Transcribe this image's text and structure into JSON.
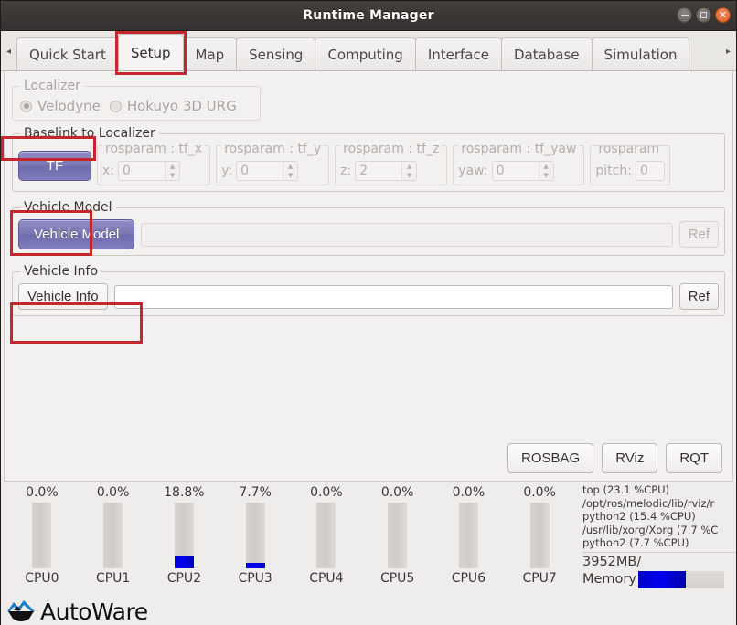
{
  "window": {
    "title": "Runtime Manager",
    "controls": [
      {
        "name": "minimize",
        "glyph": "minimize-icon"
      },
      {
        "name": "maximize",
        "glyph": "maximize-icon"
      },
      {
        "name": "close",
        "glyph": "close-icon"
      }
    ]
  },
  "tabbar": {
    "scroll_left": "◂",
    "scroll_right": "▸",
    "tabs": [
      {
        "label": "Quick Start",
        "selected": false,
        "highlighted": false
      },
      {
        "label": "Setup",
        "selected": true,
        "highlighted": true
      },
      {
        "label": "Map",
        "selected": false,
        "highlighted": false
      },
      {
        "label": "Sensing",
        "selected": false,
        "highlighted": false
      },
      {
        "label": "Computing",
        "selected": false,
        "highlighted": false
      },
      {
        "label": "Interface",
        "selected": false,
        "highlighted": false
      },
      {
        "label": "Database",
        "selected": false,
        "highlighted": false
      },
      {
        "label": "Simulation",
        "selected": false,
        "highlighted": false
      }
    ]
  },
  "localizer": {
    "legend": "Localizer",
    "options": [
      {
        "label": "Velodyne",
        "checked": true
      },
      {
        "label": "Hokuyo 3D URG",
        "checked": false
      }
    ]
  },
  "baselink": {
    "legend": "Baselink to Localizer",
    "tf_button": "TF",
    "params": [
      {
        "legend": "rosparam : tf_x",
        "label": "x:",
        "value": "0"
      },
      {
        "legend": "rosparam : tf_y",
        "label": "y:",
        "value": "0"
      },
      {
        "legend": "rosparam : tf_z",
        "label": "z:",
        "value": "2"
      },
      {
        "legend": "rosparam : tf_yaw",
        "label": "yaw:",
        "value": "0"
      },
      {
        "legend": "rosparam",
        "label": "pitch:",
        "value": "0"
      }
    ],
    "spin_up": "▲",
    "spin_down": "▼"
  },
  "vehicle_model": {
    "legend": "Vehicle Model",
    "button": "Vehicle Model",
    "path_value": "",
    "path_placeholder": "",
    "ref_button": "Ref"
  },
  "vehicle_info": {
    "legend": "Vehicle Info",
    "button": "Vehicle Info",
    "path_value": "",
    "path_placeholder": "",
    "ref_button": "Ref"
  },
  "bottom_buttons": [
    {
      "label": "ROSBAG"
    },
    {
      "label": "RViz"
    },
    {
      "label": "RQT"
    }
  ],
  "cpus": [
    {
      "name": "CPU0",
      "percent": "0.0%",
      "value": 0.0
    },
    {
      "name": "CPU1",
      "percent": "0.0%",
      "value": 0.0
    },
    {
      "name": "CPU2",
      "percent": "18.8%",
      "value": 18.8
    },
    {
      "name": "CPU3",
      "percent": "7.7%",
      "value": 7.7
    },
    {
      "name": "CPU4",
      "percent": "0.0%",
      "value": 0.0
    },
    {
      "name": "CPU5",
      "percent": "0.0%",
      "value": 0.0
    },
    {
      "name": "CPU6",
      "percent": "0.0%",
      "value": 0.0
    },
    {
      "name": "CPU7",
      "percent": "0.0%",
      "value": 0.0
    }
  ],
  "processes": [
    "top (23.1 %CPU)",
    "/opt/ros/melodic/lib/rviz/r",
    "python2 (15.4 %CPU)",
    "/usr/lib/xorg/Xorg (7.7 %C",
    "python2 (7.7 %CPU)"
  ],
  "memory": {
    "total_label": "3952MB/",
    "label": "Memory",
    "percent": 55
  },
  "logo": {
    "text": "AutoWare",
    "mark": "autoware-logo-icon"
  },
  "colors": {
    "accent_purple": "#7a77b4",
    "highlight_red": "#c4282d",
    "bar_blue": "#0000ee",
    "titlebar": "#3b3734"
  }
}
